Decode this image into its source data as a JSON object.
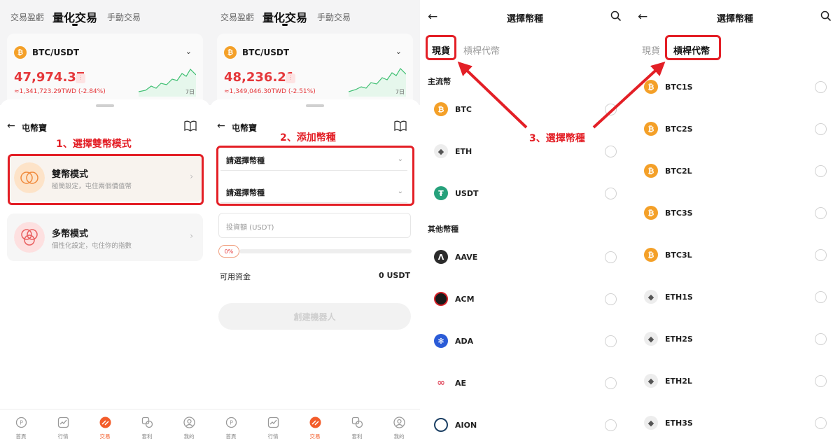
{
  "trade_tabs": [
    "交易盈虧",
    "量化交易",
    "手動交易"
  ],
  "panel1": {
    "pair": "BTC/USDT",
    "price": "47,974.37",
    "price_sub": "≈1,341,723.29TWD (-2.84%)",
    "spark_label": "7日",
    "sheet_title": "屯幣寶",
    "annotation": "1、選擇雙幣模式",
    "modes": [
      {
        "name": "雙幣模式",
        "desc": "極簡設定，屯住兩個價值幣"
      },
      {
        "name": "多幣模式",
        "desc": "個性化設定，屯住你的指數"
      }
    ]
  },
  "panel2": {
    "pair": "BTC/USDT",
    "price": "48,236.21",
    "price_sub": "≈1,349,046.30TWD (-2.51%)",
    "spark_label": "7日",
    "sheet_title": "屯幣寶",
    "annotation": "2、添加幣種",
    "select_placeholder_1": "請選擇幣種",
    "select_placeholder_2": "請選擇幣種",
    "invest_placeholder": "投資額 (USDT)",
    "progress": 0,
    "progress_label": "0%",
    "avail_label": "可用資金",
    "avail_value": "0 USDT",
    "create_button": "創建機器人"
  },
  "bottom_nav": [
    "首頁",
    "行情",
    "交易",
    "套利",
    "我的"
  ],
  "panel3": {
    "title": "選擇幣種",
    "tabs": [
      "現貨",
      "槓桿代幣"
    ],
    "annotation": "3、選擇幣種",
    "section_main": "主流幣",
    "main_coins": [
      "BTC",
      "ETH",
      "USDT"
    ],
    "section_other": "其他幣種",
    "other_coins": [
      "AAVE",
      "ACM",
      "ADA",
      "AE",
      "AION"
    ]
  },
  "panel4": {
    "title": "選擇幣種",
    "tabs": [
      "現貨",
      "槓桿代幣"
    ],
    "coins": [
      "BTC1S",
      "BTC2S",
      "BTC2L",
      "BTC3S",
      "BTC3L",
      "ETH1S",
      "ETH2S",
      "ETH2L",
      "ETH3S"
    ]
  },
  "colors": {
    "annotation_red": "#e31f26",
    "price_red": "#e5383b",
    "btc_orange": "#f4a028",
    "nav_active": "#f35c2a"
  },
  "icons": [
    "back-arrow-icon",
    "book-icon",
    "search-icon",
    "chevron-down-icon",
    "chevron-right-icon",
    "radio-icon"
  ]
}
